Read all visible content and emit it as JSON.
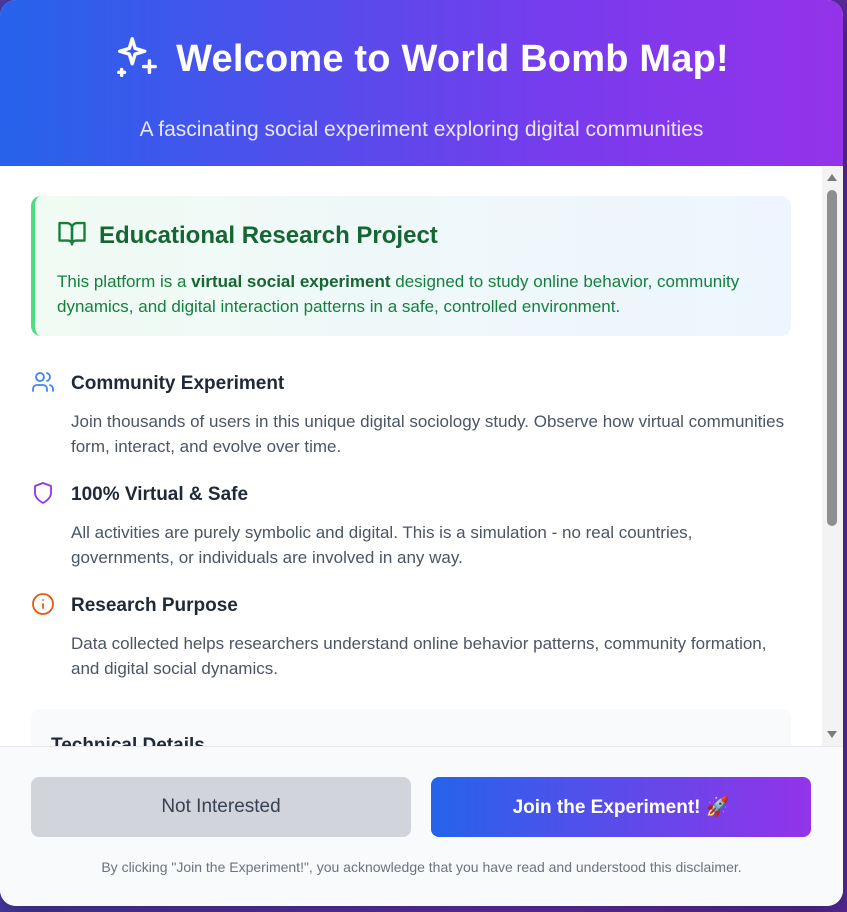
{
  "header": {
    "title": "Welcome to World Bomb Map!",
    "subtitle": "A fascinating social experiment exploring digital communities",
    "icon": "sparkles-icon"
  },
  "edu_box": {
    "icon": "book-open-icon",
    "title": "Educational Research Project",
    "text_before": "This platform is a ",
    "text_bold": "virtual social experiment",
    "text_after": " designed to study online behavior, community dynamics, and digital interaction patterns in a safe, controlled environment."
  },
  "features": [
    {
      "icon": "users-icon",
      "title": "Community Experiment",
      "text": "Join thousands of users in this unique digital sociology study. Observe how virtual communities form, interact, and evolve over time."
    },
    {
      "icon": "shield-icon",
      "title": "100% Virtual & Safe",
      "text": "All activities are purely symbolic and digital. This is a simulation - no real countries, governments, or individuals are involved in any way."
    },
    {
      "icon": "info-icon",
      "title": "Research Purpose",
      "text": "Data collected helps researchers understand online behavior patterns, community formation, and digital social dynamics."
    }
  ],
  "technical": {
    "title": "Technical Details"
  },
  "footer": {
    "decline_label": "Not Interested",
    "accept_label": "Join the Experiment! 🚀",
    "disclaimer": "By clicking \"Join the Experiment!\", you acknowledge that you have read and understood this disclaimer."
  },
  "colors": {
    "header_gradient_start": "#2563eb",
    "header_gradient_end": "#9333ea",
    "edu_green": "#166534",
    "users_icon": "#3b82f6",
    "shield_icon": "#9333ea",
    "info_icon": "#ea580c"
  }
}
